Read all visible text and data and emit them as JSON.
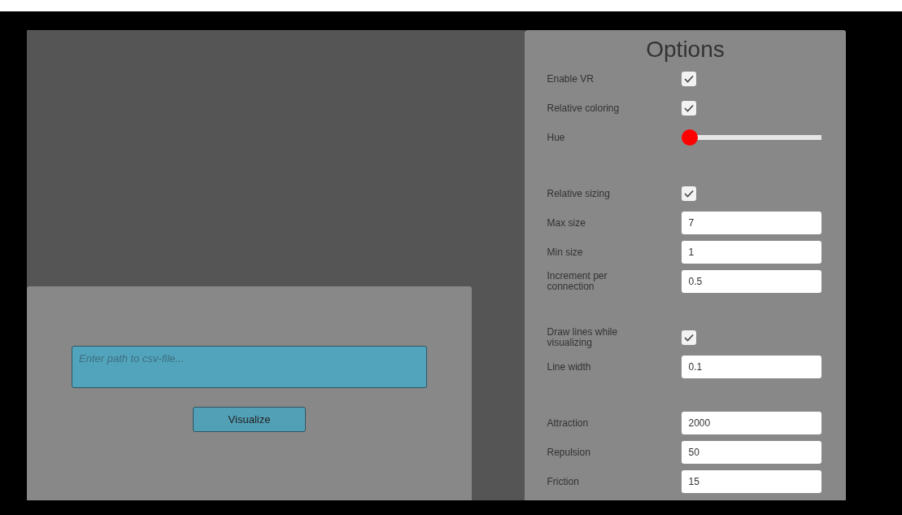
{
  "file_panel": {
    "path_field": {
      "placeholder": "Enter path to csv-file..."
    },
    "button": "Visualize"
  },
  "options": {
    "title": "Options",
    "groups": [
      {
        "rows": [
          {
            "kind": "checkbox",
            "label": "Enable VR",
            "checked": true
          },
          {
            "kind": "checkbox",
            "label": "Relative coloring",
            "checked": true
          },
          {
            "kind": "slider",
            "label": "Hue",
            "level": 0
          }
        ]
      },
      {
        "rows": [
          {
            "kind": "checkbox",
            "label": "Relative sizing",
            "checked": true
          },
          {
            "kind": "input",
            "label": "Max size",
            "value": "7"
          },
          {
            "kind": "input",
            "label": "Min size",
            "value": "1"
          },
          {
            "kind": "input",
            "label": "Increment per connection",
            "value": "0.5"
          }
        ]
      },
      {
        "rows": [
          {
            "kind": "checkbox",
            "label": "Draw lines while visualizing",
            "checked": true
          },
          {
            "kind": "input",
            "label": "Line width",
            "value": "0.1"
          }
        ]
      },
      {
        "rows": [
          {
            "kind": "input",
            "label": "Attraction",
            "value": "2000"
          },
          {
            "kind": "input",
            "label": "Repulsion",
            "value": "50"
          },
          {
            "kind": "input",
            "label": "Friction",
            "value": "15"
          }
        ]
      }
    ]
  }
}
